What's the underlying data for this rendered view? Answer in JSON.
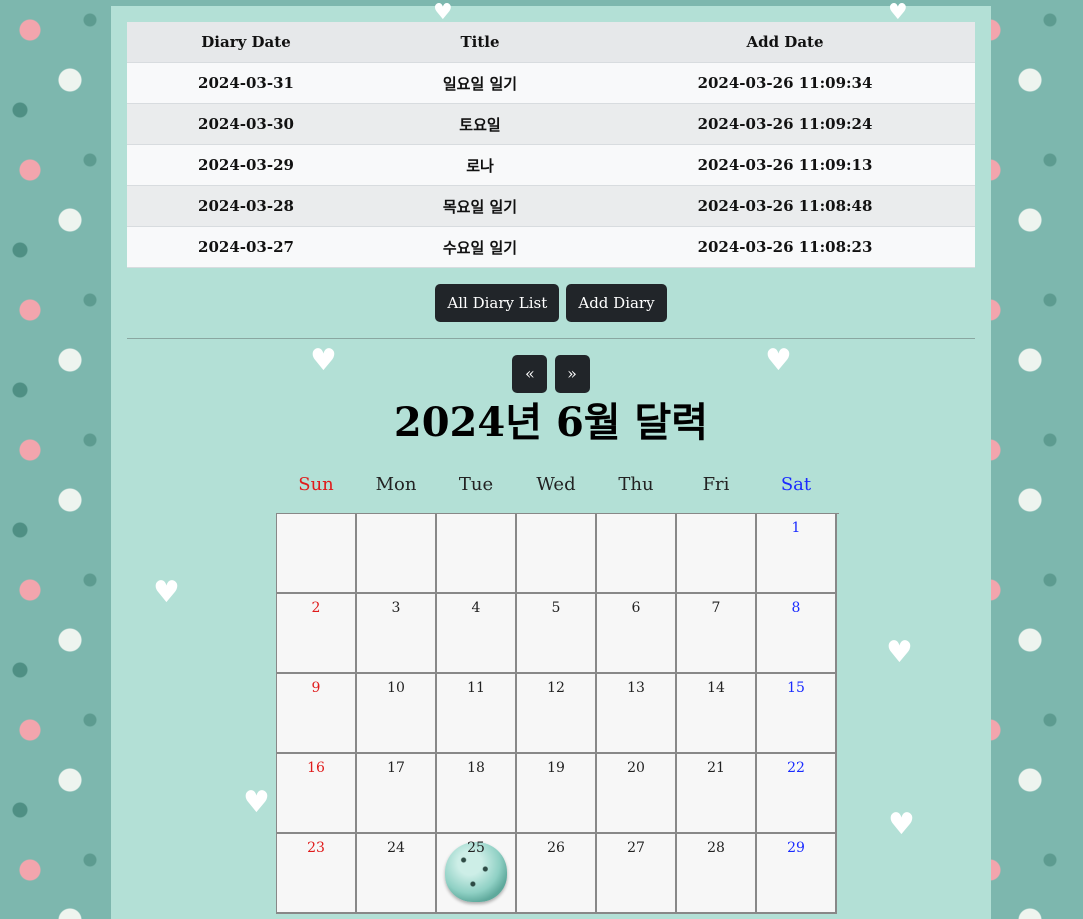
{
  "table": {
    "headers": [
      "Diary Date",
      "Title",
      "Add Date"
    ],
    "rows": [
      {
        "date": "2024-03-31",
        "title": "일요일 일기",
        "added": "2024-03-26 11:09:34"
      },
      {
        "date": "2024-03-30",
        "title": "토요일",
        "added": "2024-03-26 11:09:24"
      },
      {
        "date": "2024-03-29",
        "title": "로나",
        "added": "2024-03-26 11:09:13"
      },
      {
        "date": "2024-03-28",
        "title": "목요일 일기",
        "added": "2024-03-26 11:08:48"
      },
      {
        "date": "2024-03-27",
        "title": "수요일 일기",
        "added": "2024-03-26 11:08:23"
      }
    ]
  },
  "buttons": {
    "all_diary_list": "All Diary List",
    "add_diary": "Add Diary"
  },
  "nav": {
    "prev": "«",
    "next": "»"
  },
  "calendar": {
    "title": "2024년 6월 달력",
    "weekdays": [
      "Sun",
      "Mon",
      "Tue",
      "Wed",
      "Thu",
      "Fri",
      "Sat"
    ],
    "weeks": [
      [
        "",
        "",
        "",
        "",
        "",
        "",
        "1"
      ],
      [
        "2",
        "3",
        "4",
        "5",
        "6",
        "7",
        "8"
      ],
      [
        "9",
        "10",
        "11",
        "12",
        "13",
        "14",
        "15"
      ],
      [
        "16",
        "17",
        "18",
        "19",
        "20",
        "21",
        "22"
      ],
      [
        "23",
        "24",
        "25",
        "26",
        "27",
        "28",
        "29"
      ]
    ],
    "sticker_day": "25",
    "sunday_color": "#e01b1b",
    "saturday_color": "#1a2bff"
  },
  "colors": {
    "panel_bg": "#b3e0d6",
    "button_bg": "#212529"
  }
}
